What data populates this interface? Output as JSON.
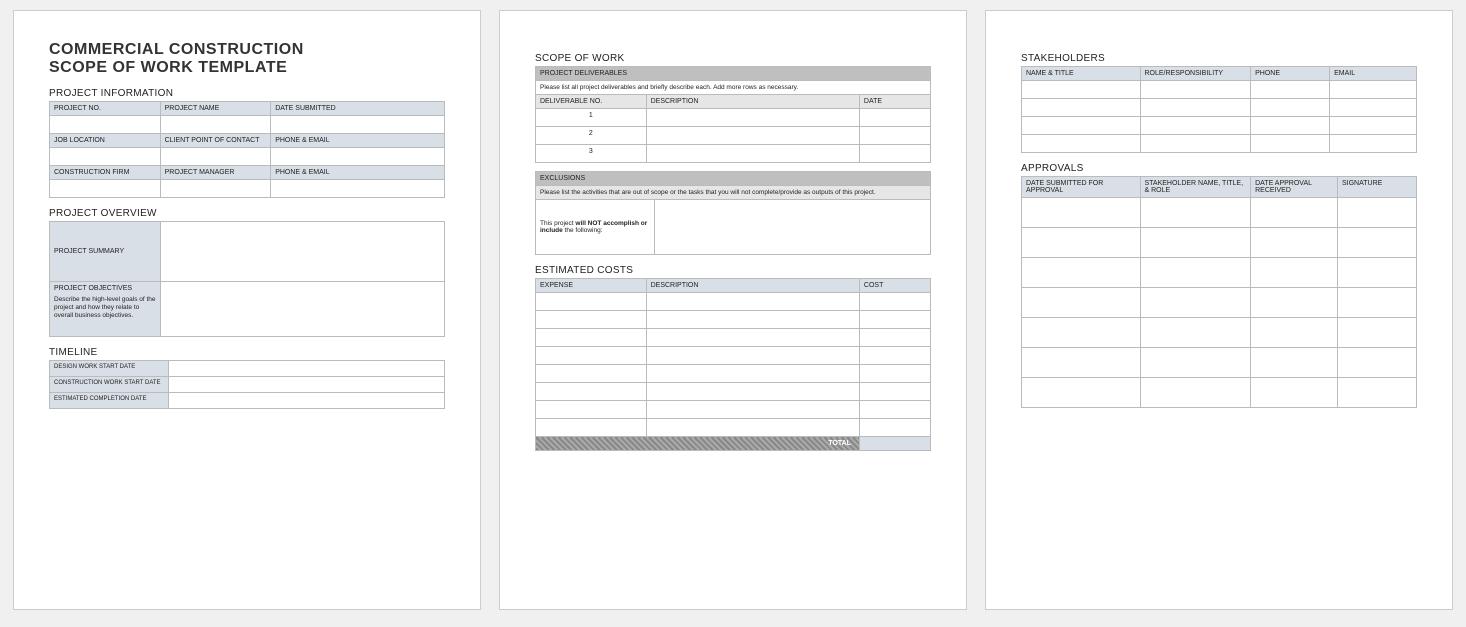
{
  "doc_title_line1": "COMMERCIAL CONSTRUCTION",
  "doc_title_line2": "SCOPE OF WORK TEMPLATE",
  "sec_project_info": "PROJECT INFORMATION",
  "pi": {
    "project_no": "PROJECT NO.",
    "project_name": "PROJECT NAME",
    "date_submitted": "DATE SUBMITTED",
    "job_location": "JOB LOCATION",
    "client_poc": "CLIENT POINT OF CONTACT",
    "phone_email": "PHONE & EMAIL",
    "construction_firm": "CONSTRUCTION FIRM",
    "project_manager": "PROJECT MANAGER"
  },
  "sec_overview": "PROJECT OVERVIEW",
  "po": {
    "summary": "PROJECT SUMMARY",
    "objectives": "PROJECT OBJECTIVES",
    "objectives_desc": "Describe the high-level goals of the project and how they relate to overall business objectives."
  },
  "sec_timeline": "TIMELINE",
  "tl": {
    "design_start": "DESIGN WORK START DATE",
    "construction_start": "CONSTRUCTION WORK START DATE",
    "est_complete": "ESTIMATED COMPLETION DATE"
  },
  "sec_sow": "SCOPE OF WORK",
  "sow": {
    "deliverables_hdr": "PROJECT DELIVERABLES",
    "deliverables_desc": "Please list all project deliverables and briefly describe each. Add more rows as necessary.",
    "col_deliverable_no": "DELIVERABLE NO.",
    "col_description": "DESCRIPTION",
    "col_date": "DATE",
    "row1": "1",
    "row2": "2",
    "row3": "3",
    "exclusions_hdr": "EXCLUSIONS",
    "exclusions_desc": "Please list the activities that are out of scope or the tasks that you will not complete/provide as outputs of this project.",
    "excl_label_a": "This project ",
    "excl_label_b": "will NOT accomplish or include",
    "excl_label_c": " the following:"
  },
  "sec_costs": "ESTIMATED COSTS",
  "costs": {
    "col_expense": "EXPENSE",
    "col_description": "DESCRIPTION",
    "col_cost": "COST",
    "total": "TOTAL"
  },
  "sec_stakeholders": "STAKEHOLDERS",
  "sh": {
    "col_name_title": "NAME & TITLE",
    "col_role": "ROLE/RESPONSIBILITY",
    "col_phone": "PHONE",
    "col_email": "EMAIL"
  },
  "sec_approvals": "APPROVALS",
  "ap": {
    "col_date_submitted": "DATE SUBMITTED FOR APPROVAL",
    "col_sh_name": "STAKEHOLDER NAME, TITLE, & ROLE",
    "col_date_received": "DATE APPROVAL RECEIVED",
    "col_signature": "SIGNATURE"
  }
}
